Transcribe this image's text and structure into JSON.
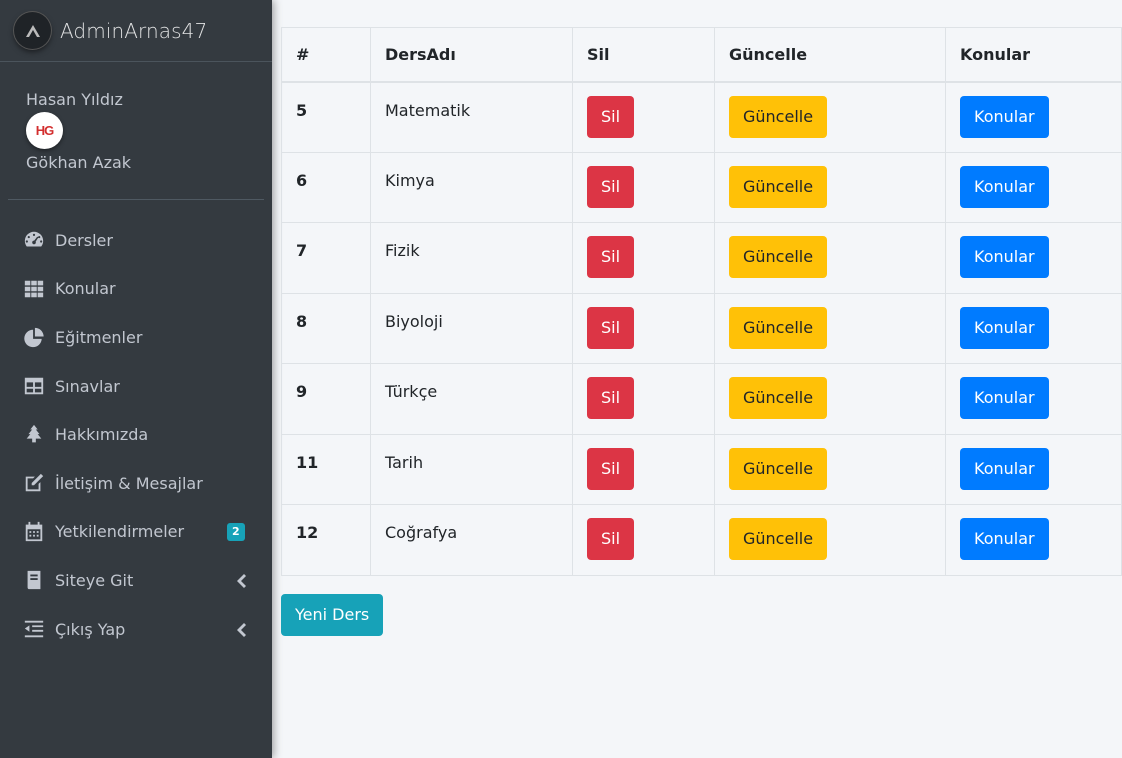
{
  "brand": {
    "name": "AdminArnas47",
    "logo_icon": "a-logo-icon"
  },
  "user_panel": {
    "name1": "Hasan Yıldız",
    "avatar_text": "HG",
    "name2": "Gökhan Azak"
  },
  "nav": [
    {
      "label": "Dersler",
      "icon": "tachometer-icon"
    },
    {
      "label": "Konular",
      "icon": "grid-icon"
    },
    {
      "label": "Eğitmenler",
      "icon": "pie-chart-icon"
    },
    {
      "label": "Sınavlar",
      "icon": "table-icon"
    },
    {
      "label": "Hakkımızda",
      "icon": "tree-icon"
    },
    {
      "label": "İletişim & Mesajlar",
      "icon": "edit-icon"
    },
    {
      "label": "Yetkilendirmeler",
      "icon": "calendar-icon",
      "badge": "2"
    },
    {
      "label": "Siteye Git",
      "icon": "book-icon",
      "chevron": "chevron-left-icon"
    },
    {
      "label": "Çıkış Yap",
      "icon": "outdent-icon",
      "chevron": "chevron-left-icon"
    }
  ],
  "table": {
    "headers": [
      "#",
      "DersAdı",
      "Sil",
      "Güncelle",
      "Konular"
    ],
    "delete_label": "Sil",
    "update_label": "Güncelle",
    "topics_label": "Konular",
    "rows": [
      {
        "id": "5",
        "name": "Matematik"
      },
      {
        "id": "6",
        "name": "Kimya"
      },
      {
        "id": "7",
        "name": "Fizik"
      },
      {
        "id": "8",
        "name": "Biyoloji"
      },
      {
        "id": "9",
        "name": "Türkçe"
      },
      {
        "id": "11",
        "name": "Tarih"
      },
      {
        "id": "12",
        "name": "Coğrafya"
      }
    ]
  },
  "new_button_label": "Yeni Ders",
  "colors": {
    "sidebar": "#343a40",
    "danger": "#dc3545",
    "warning": "#ffc107",
    "primary": "#007bff",
    "info": "#17a2b8"
  }
}
